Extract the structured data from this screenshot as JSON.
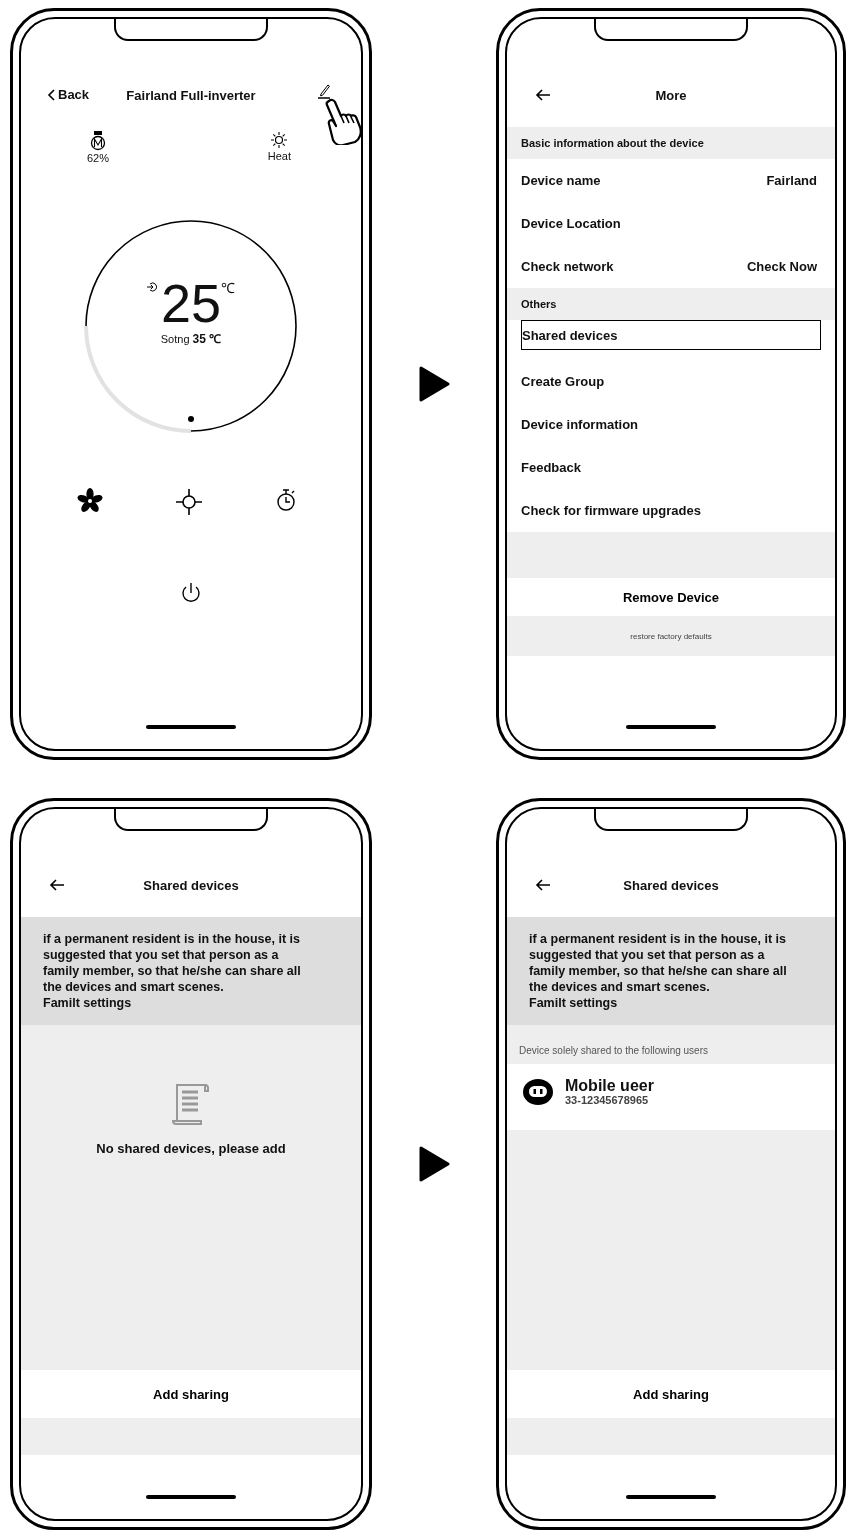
{
  "screens": [
    {
      "kind": "control",
      "back": "Back",
      "title": "Fairland Full-inverter",
      "status": [
        {
          "kind": "motor",
          "value": "62%"
        },
        {
          "kind": "sun",
          "value": "Heat"
        }
      ],
      "temperature": "25",
      "unit": "℃",
      "setting": "Sotng **35 ℃**"
    },
    {
      "kind": "menu",
      "title": "More",
      "items": [
        {
          "kind": "header",
          "label": "Basic information about the device"
        },
        {
          "kind": "row",
          "label": "Device name",
          "value": "Fairland",
          "selected": false
        },
        {
          "kind": "row",
          "label": "Device Location",
          "selected": false
        },
        {
          "kind": "row",
          "label": "Check network",
          "value": "Check Now",
          "selected": false
        },
        {
          "kind": "header",
          "label": "Others"
        },
        {
          "kind": "row",
          "label": "Shared devices",
          "selected": true
        },
        {
          "kind": "row",
          "label": "Create Group",
          "selected": false
        },
        {
          "kind": "row",
          "label": "Device information",
          "selected": false
        },
        {
          "kind": "row",
          "label": "Feedback",
          "selected": false
        },
        {
          "kind": "row",
          "label": "Check for firmware upgrades",
          "selected": false
        }
      ],
      "remove_button": "Remove Device",
      "restore": "restore factory defaults"
    },
    {
      "kind": "shared",
      "title": "Shared devices",
      "notice": "if a permanent resident is in the house, it is suggested that you set that person as a family member, so that he/she can share all the devices and smart scenes.",
      "notice_link": "Familt settings",
      "empty_message": "No shared devices, please add",
      "add_button": "Add sharing"
    },
    {
      "kind": "shared",
      "title": "Shared devices",
      "notice": "if a permanent resident is in the house, it is suggested that you set that person as a family member, so that he/she can share all the devices and smart scenes.",
      "notice_link": "Familt settings",
      "users_heading": "Device solely shared to the following users",
      "users": [
        {
          "name": "Mobile ueer",
          "phone": "33-12345678965"
        }
      ],
      "add_button": "Add sharing"
    }
  ]
}
